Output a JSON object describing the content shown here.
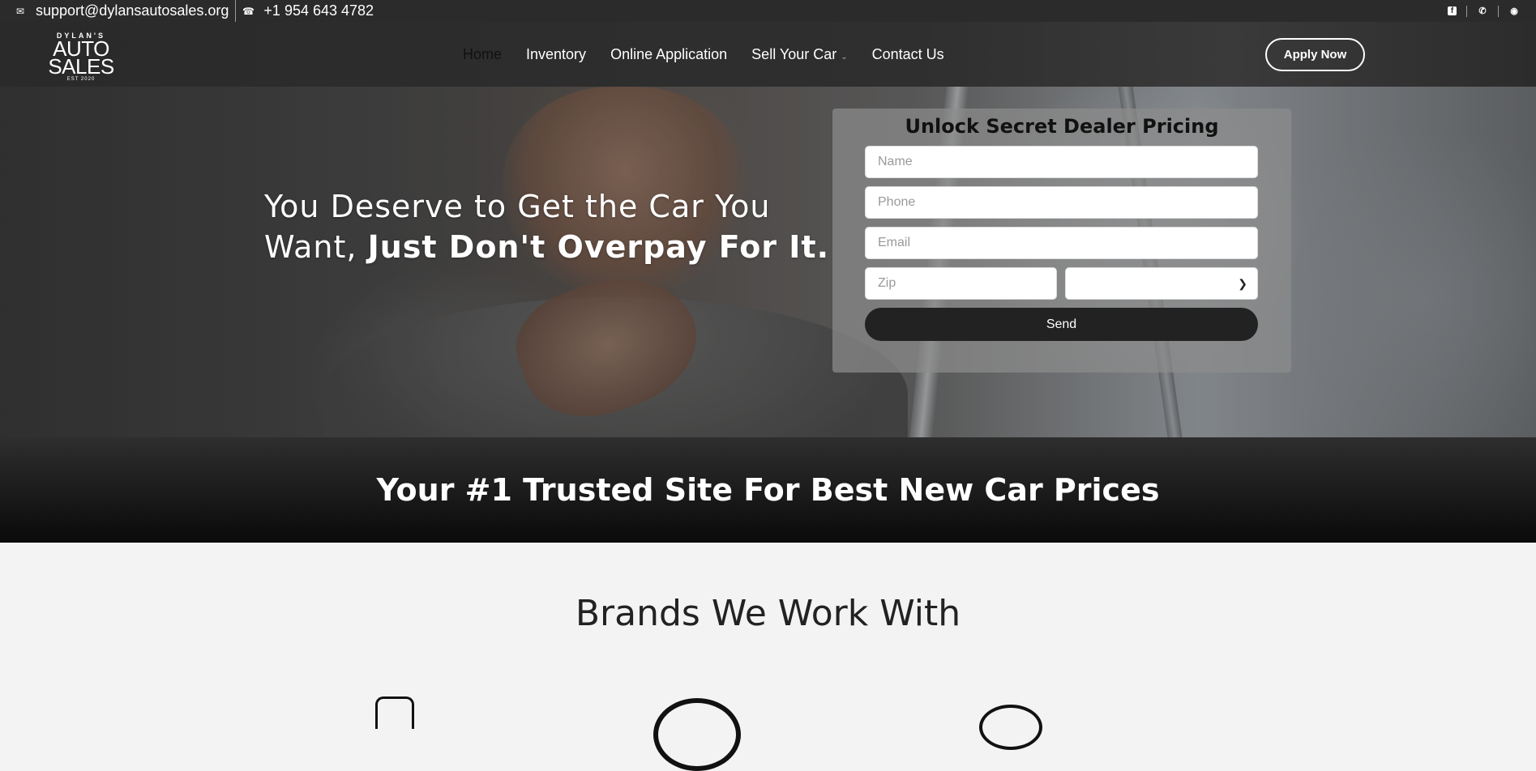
{
  "topbar": {
    "email": "support@dylansautosales.org",
    "phone": "+1 954 643 4782",
    "email_icon": "email-icon",
    "phone_icon": "phone-icon",
    "socials": [
      "facebook-icon",
      "whatsapp-icon",
      "instagram-icon"
    ]
  },
  "logo": {
    "line1": "DYLAN'S",
    "line2": "AUTO SALES",
    "line3": "EST 2020"
  },
  "nav": {
    "items": [
      "Home",
      "Inventory",
      "Online Application",
      "Sell Your Car",
      "Contact Us"
    ],
    "active": "Home",
    "apply_label": "Apply Now"
  },
  "hero": {
    "line1": "You Deserve to Get the Car You",
    "line2_prefix": "Want, ",
    "line2_bold": "Just Don't Overpay For It."
  },
  "form": {
    "title": "Unlock Secret Dealer Pricing",
    "name_placeholder": "Name",
    "phone_placeholder": "Phone",
    "email_placeholder": "Email",
    "zip_placeholder": "Zip",
    "select_value": "",
    "send_label": "Send"
  },
  "band": {
    "title": "Your #1 Trusted Site For Best New Car Prices"
  },
  "brands": {
    "title": "Brands We Work With",
    "logos": [
      "honda-logo",
      "nissan-logo",
      "toyota-logo"
    ]
  },
  "colors": {
    "dark": "#2b2b2b",
    "button_dark": "#222222",
    "page_bg": "#f3f3f3"
  }
}
